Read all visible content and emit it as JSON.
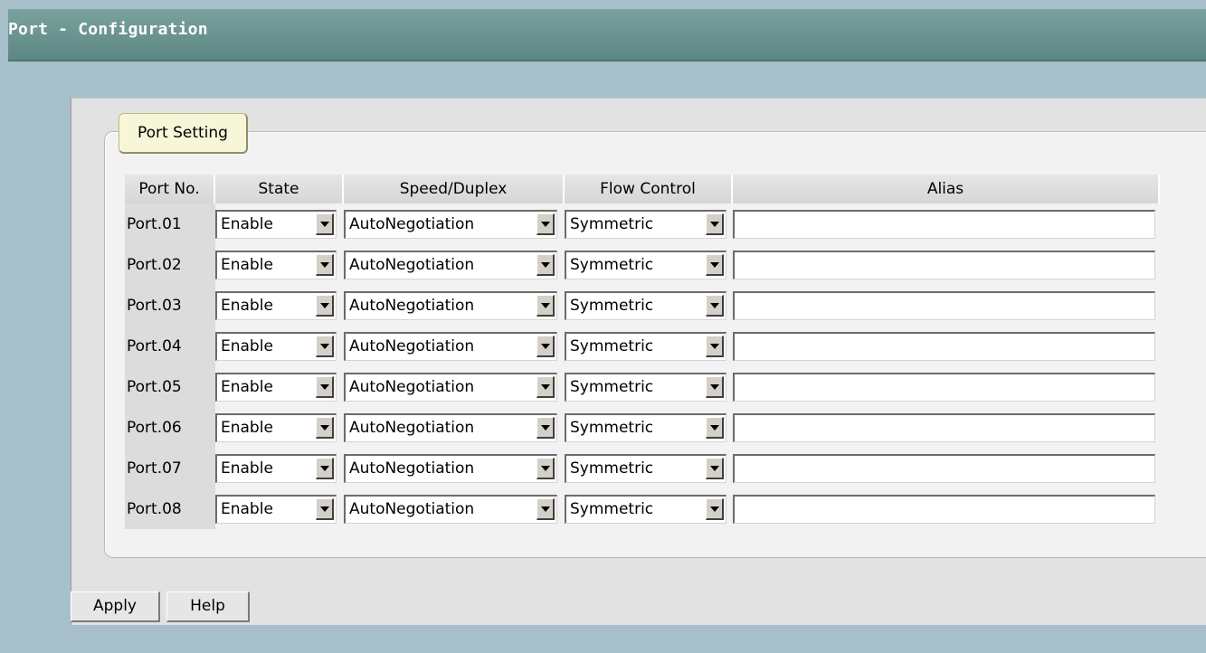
{
  "header": {
    "title": "Port - Configuration"
  },
  "port_setting": {
    "legend": "Port Setting",
    "columns": [
      "Port No.",
      "State",
      "Speed/Duplex",
      "Flow Control",
      "Alias"
    ],
    "rows": [
      {
        "port": "Port.01",
        "state": "Enable",
        "speed": "AutoNegotiation",
        "flow": "Symmetric",
        "alias": ""
      },
      {
        "port": "Port.02",
        "state": "Enable",
        "speed": "AutoNegotiation",
        "flow": "Symmetric",
        "alias": ""
      },
      {
        "port": "Port.03",
        "state": "Enable",
        "speed": "AutoNegotiation",
        "flow": "Symmetric",
        "alias": ""
      },
      {
        "port": "Port.04",
        "state": "Enable",
        "speed": "AutoNegotiation",
        "flow": "Symmetric",
        "alias": ""
      },
      {
        "port": "Port.05",
        "state": "Enable",
        "speed": "AutoNegotiation",
        "flow": "Symmetric",
        "alias": ""
      },
      {
        "port": "Port.06",
        "state": "Enable",
        "speed": "AutoNegotiation",
        "flow": "Symmetric",
        "alias": ""
      },
      {
        "port": "Port.07",
        "state": "Enable",
        "speed": "AutoNegotiation",
        "flow": "Symmetric",
        "alias": ""
      },
      {
        "port": "Port.08",
        "state": "Enable",
        "speed": "AutoNegotiation",
        "flow": "Symmetric",
        "alias": ""
      }
    ]
  },
  "buttons": {
    "apply": "Apply",
    "help": "Help"
  }
}
